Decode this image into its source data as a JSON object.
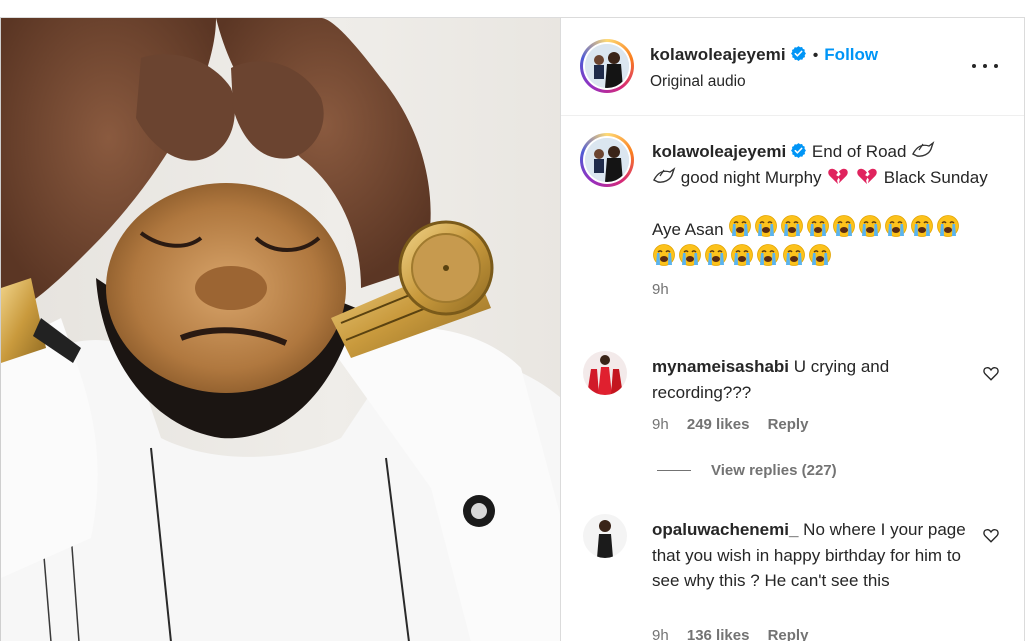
{
  "post": {
    "username": "kolawoleajeyemi",
    "verified": true,
    "follow_label": "Follow",
    "audio_label": "Original audio",
    "more_icon": "more-horizontal-icon"
  },
  "caption": {
    "username": "kolawoleajeyemi",
    "text_1": "End of Road",
    "text_2": "good night Murphy",
    "text_3": "Black Sunday",
    "text_4": "Aye Asan",
    "time": "9h",
    "emojis": {
      "dove": "dove-emoji",
      "broken_heart": "broken-heart-emoji",
      "crying": "loudly-crying-face-emoji",
      "crying_count_line1": 9,
      "crying_count_line2": 7
    }
  },
  "comments": [
    {
      "username": "mynameisashabi",
      "text": "U crying and recording???",
      "time": "9h",
      "likes": "249 likes",
      "reply_label": "Reply",
      "view_replies": "View replies (227)"
    },
    {
      "username": "opaluwachenemi_",
      "text": "No where I your page that you wish in happy birthday for him to see why this ? He can't see this",
      "time": "9h",
      "likes": "136 likes",
      "reply_label": "Reply"
    }
  ],
  "colors": {
    "link_blue": "#0095f6",
    "verified_blue": "#0095f6",
    "meta_gray": "#737373",
    "text": "#262626",
    "heart_red": "#e0245e"
  }
}
